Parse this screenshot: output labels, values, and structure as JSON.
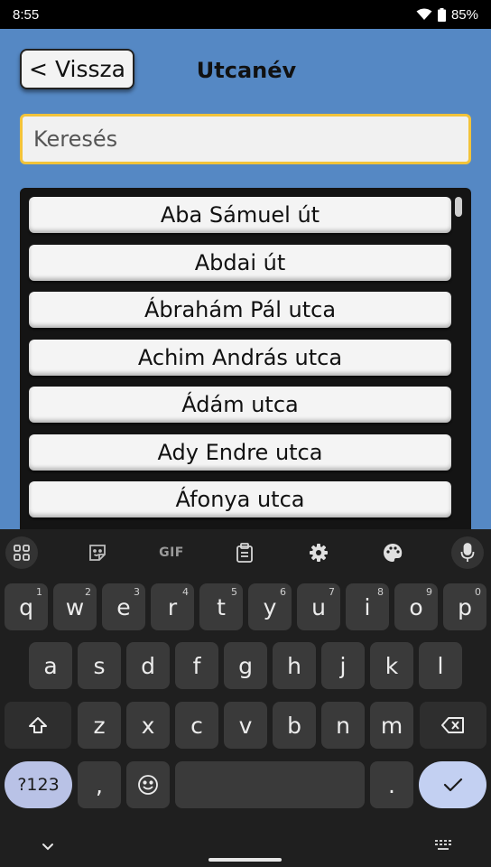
{
  "status_bar": {
    "time": "8:55",
    "battery": "85%"
  },
  "header": {
    "back_label": "< Vissza",
    "title": "Utcanév"
  },
  "search": {
    "placeholder": "Keresés",
    "value": ""
  },
  "streets": [
    "Aba Sámuel út",
    "Abdai út",
    "Ábrahám Pál utca",
    "Achim András utca",
    "Ádám utca",
    "Ady Endre utca",
    "Áfonya utca"
  ],
  "keyboard": {
    "toolbar": {
      "gif_label": "GIF"
    },
    "row1": [
      {
        "key": "q",
        "hint": "1"
      },
      {
        "key": "w",
        "hint": "2"
      },
      {
        "key": "e",
        "hint": "3"
      },
      {
        "key": "r",
        "hint": "4"
      },
      {
        "key": "t",
        "hint": "5"
      },
      {
        "key": "y",
        "hint": "6"
      },
      {
        "key": "u",
        "hint": "7"
      },
      {
        "key": "i",
        "hint": "8"
      },
      {
        "key": "o",
        "hint": "9"
      },
      {
        "key": "p",
        "hint": "0"
      }
    ],
    "row2": [
      "a",
      "s",
      "d",
      "f",
      "g",
      "h",
      "j",
      "k",
      "l"
    ],
    "row3": [
      "z",
      "x",
      "c",
      "v",
      "b",
      "n",
      "m"
    ],
    "row4": {
      "symbols_label": "?123",
      "comma": ",",
      "period": "."
    }
  },
  "colors": {
    "app_background": "#5588c4",
    "search_border": "#f2c33a",
    "list_background": "#141414",
    "keyboard_background": "#1f1f1f"
  }
}
